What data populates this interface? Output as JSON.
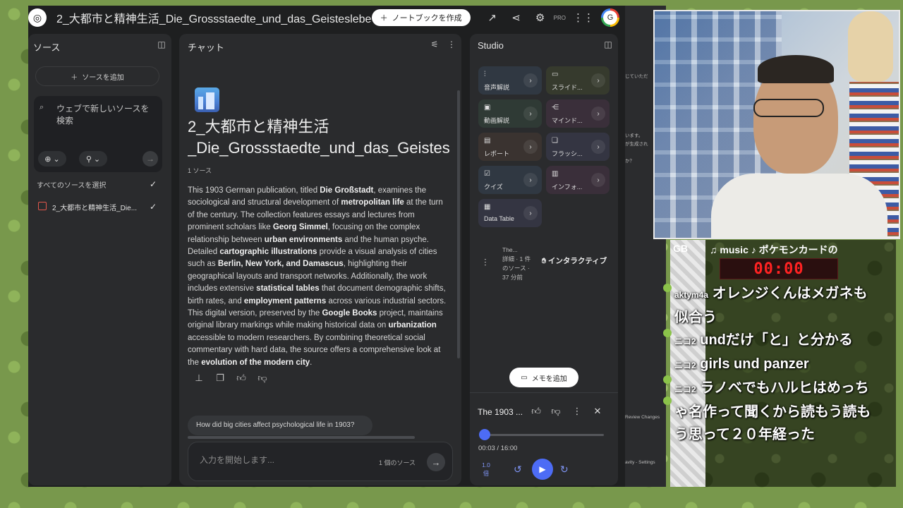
{
  "notebook": {
    "title": "2_大都市と精神生活_Die_Grossstaedte_und_das_Geisteslebe",
    "create_button": "ノートブックを作成",
    "pro_badge": "PRO",
    "avatar_letter": "G"
  },
  "sources": {
    "title": "ソース",
    "add_button": "ソースを追加",
    "search_placeholder": "ウェブで新しいソースを検索",
    "select_all": "すべてのソースを選択",
    "items": [
      {
        "label": "2_大都市と精神生活_Die..."
      }
    ]
  },
  "chat": {
    "title": "チャット",
    "notebook_heading_line1": "2_大都市と精神生活",
    "notebook_heading_line2": "_Die_Grossstaedte_und_das_Geistes",
    "source_count": "1 ソース",
    "summary": [
      {
        "t": "This 1903 German publication, titled ",
        "b": false
      },
      {
        "t": "Die Großstadt",
        "b": true
      },
      {
        "t": ", examines the sociological and structural development of ",
        "b": false
      },
      {
        "t": "metropolitan life",
        "b": true
      },
      {
        "t": " at the turn of the century. The collection features essays and lectures from prominent scholars like ",
        "b": false
      },
      {
        "t": "Georg Simmel",
        "b": true
      },
      {
        "t": ", focusing on the complex relationship between ",
        "b": false
      },
      {
        "t": "urban environments",
        "b": true
      },
      {
        "t": " and the human psyche. Detailed ",
        "b": false
      },
      {
        "t": "cartographic illustrations",
        "b": true
      },
      {
        "t": " provide a visual analysis of cities such as ",
        "b": false
      },
      {
        "t": "Berlin, New York, and Damascus",
        "b": true
      },
      {
        "t": ", highlighting their geographical layouts and transport networks. Additionally, the work includes extensive ",
        "b": false
      },
      {
        "t": "statistical tables",
        "b": true
      },
      {
        "t": " that document demographic shifts, birth rates, and ",
        "b": false
      },
      {
        "t": "employment patterns",
        "b": true
      },
      {
        "t": " across various industrial sectors. This digital version, preserved by the ",
        "b": false
      },
      {
        "t": "Google Books",
        "b": true
      },
      {
        "t": " project, maintains original library markings while making historical data on ",
        "b": false
      },
      {
        "t": "urbanization",
        "b": true
      },
      {
        "t": " accessible to modern researchers. By combining theoretical social commentary with hard data, the source offers a comprehensive look at the ",
        "b": false
      },
      {
        "t": "evolution of the modern city",
        "b": true
      },
      {
        "t": ".",
        "b": false
      }
    ],
    "suggestion": "How did big cities affect psychological life in 1903?",
    "input_placeholder": "入力を開始します...",
    "input_source_count": "1 個のソース"
  },
  "studio": {
    "title": "Studio",
    "tiles": [
      {
        "label": "音声解説"
      },
      {
        "label": "スライド..."
      },
      {
        "label": "動画解説"
      },
      {
        "label": "マインド..."
      },
      {
        "label": "レポート"
      },
      {
        "label": "フラッシ..."
      },
      {
        "label": "クイズ"
      },
      {
        "label": "インフォ..."
      },
      {
        "label": "Data Table"
      }
    ],
    "generated": {
      "title": "The...",
      "meta": "詳細 · 1 件のソース · 37 分前",
      "interactive": "インタラクティブ"
    },
    "memo_button": "メモを追加",
    "player": {
      "title": "The 1903 ...",
      "time": "00:03 / 16:00",
      "speed": "1.0 倍",
      "progress_fraction": 0.003
    }
  },
  "stream": {
    "gb": "GB",
    "music": "♫ music ♪ ポケモンカードの",
    "timer": "00:00",
    "comments": [
      {
        "user": "aktym4a",
        "text": "オレンジくんはメガネも似合う"
      },
      {
        "user": "ニコ2",
        "text": "undだけ「と」と分かる"
      },
      {
        "user": "ニコ2",
        "text": "girls und panzer"
      },
      {
        "user": "ニコ2",
        "text": "ラノベでもハルヒはめっちゃ名作って聞くから読もう読もう思って２０年経った"
      }
    ],
    "background_strip": [
      "じていただ",
      "います。",
      "が生成され",
      "か？",
      "Review Changes",
      "avity - Settings"
    ]
  },
  "colors": {
    "accent": "#4d6cf5",
    "panel": "#2a2b2d",
    "timer_red": "#ff2222"
  }
}
